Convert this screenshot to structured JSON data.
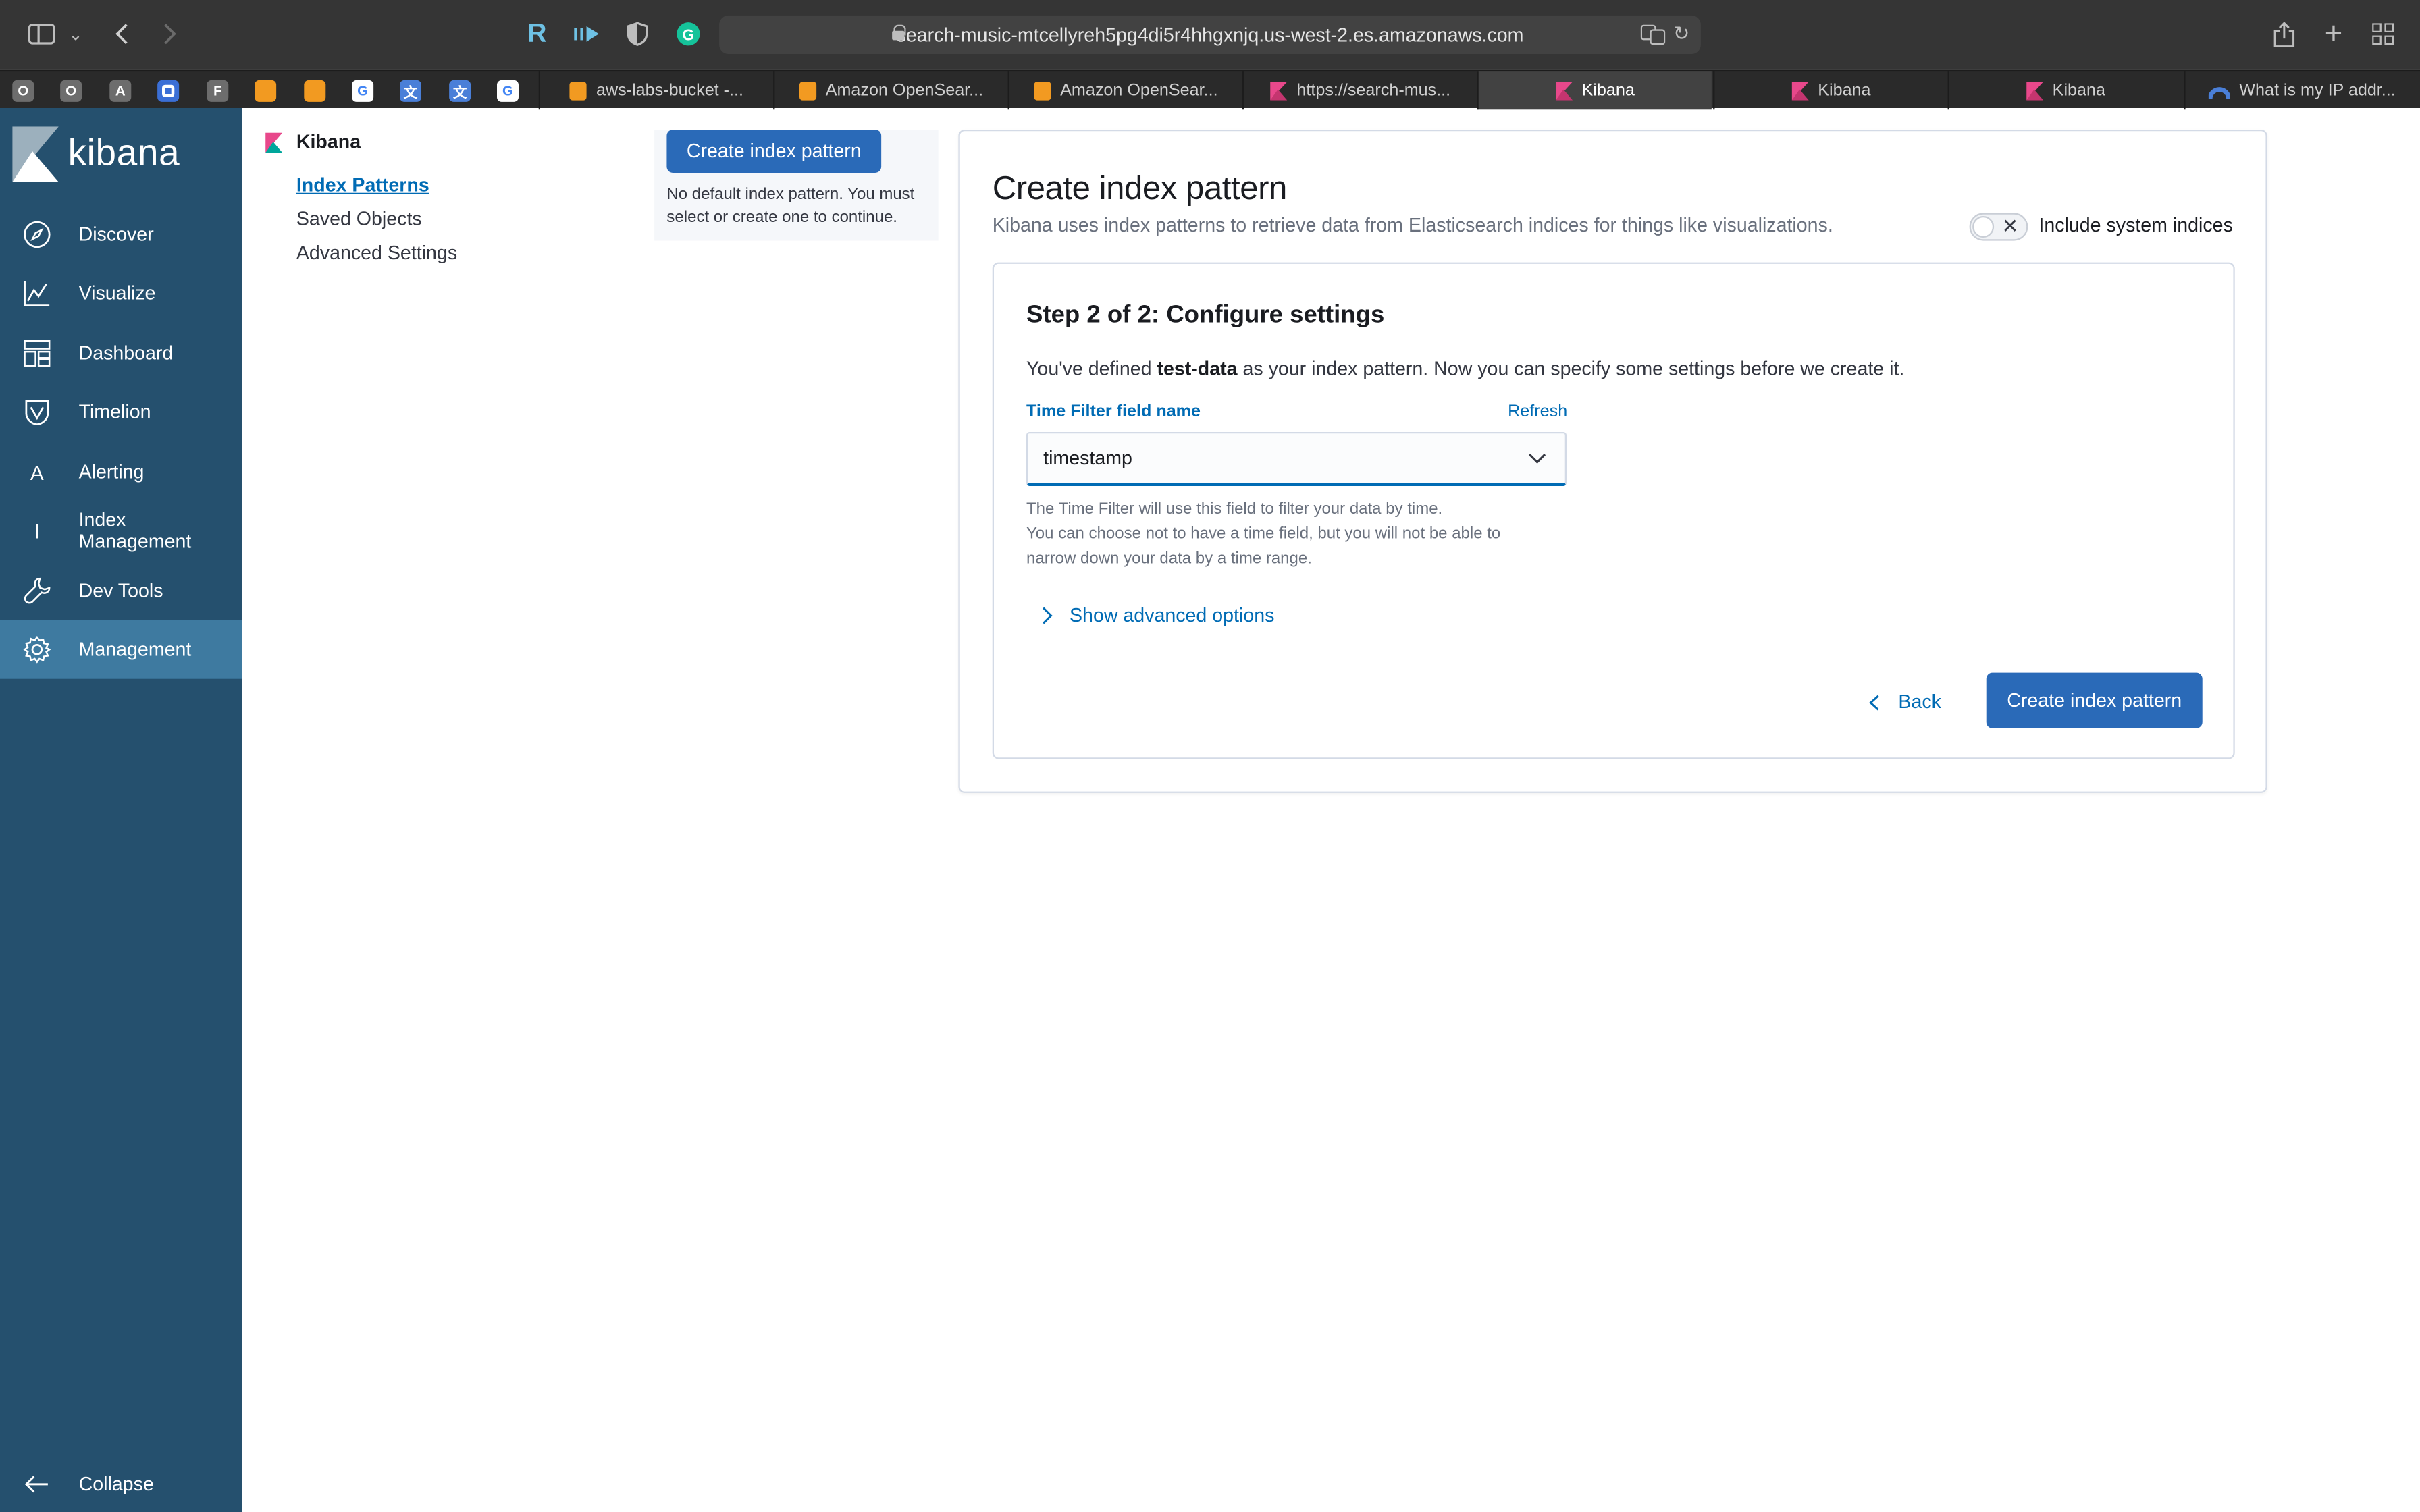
{
  "browser": {
    "url": "search-music-mtcellyreh5pg4di5r4hhgxnjq.us-west-2.es.amazonaws.com",
    "pinned_tabs": [
      "O",
      "O",
      "A",
      "",
      "F",
      "",
      "",
      "",
      "",
      "",
      ""
    ],
    "tabs": [
      {
        "title": "aws-labs-bucket -...",
        "favicon": "aws-icon",
        "active": false
      },
      {
        "title": "Amazon OpenSear...",
        "favicon": "aws-icon",
        "active": false
      },
      {
        "title": "Amazon OpenSear...",
        "favicon": "aws-icon",
        "active": false
      },
      {
        "title": "https://search-mus...",
        "favicon": "kibana-icon",
        "active": false
      },
      {
        "title": "Kibana",
        "favicon": "kibana-icon",
        "active": true
      },
      {
        "title": "Kibana",
        "favicon": "kibana-icon",
        "active": false
      },
      {
        "title": "Kibana",
        "favicon": "kibana-icon",
        "active": false
      },
      {
        "title": "What is my IP addr...",
        "favicon": "ip-icon",
        "active": false
      }
    ]
  },
  "sidebar": {
    "brand": "kibana",
    "items": [
      {
        "label": "Discover",
        "icon": "compass-icon"
      },
      {
        "label": "Visualize",
        "icon": "chart-icon"
      },
      {
        "label": "Dashboard",
        "icon": "dashboard-icon"
      },
      {
        "label": "Timelion",
        "icon": "timelion-icon"
      },
      {
        "label": "Alerting",
        "icon": "letter-a-icon",
        "glyph": "A"
      },
      {
        "label": "Index Management",
        "icon": "letter-i-icon",
        "glyph": "I"
      },
      {
        "label": "Dev Tools",
        "icon": "wrench-icon"
      },
      {
        "label": "Management",
        "icon": "gear-icon",
        "active": true
      }
    ],
    "collapse_label": "Collapse"
  },
  "subnav": {
    "title": "Kibana",
    "links": [
      "Index Patterns",
      "Saved Objects",
      "Advanced Settings"
    ],
    "selected": "Index Patterns"
  },
  "index_list": {
    "create_button": "Create index pattern",
    "hint": "No default index pattern. You must select or create one to continue."
  },
  "main": {
    "title": "Create index pattern",
    "description": "Kibana uses index patterns to retrieve data from Elasticsearch indices for things like visualizations.",
    "include_system_indices_label": "Include system indices",
    "include_system_indices": false,
    "step": {
      "title": "Step 2 of 2: Configure settings",
      "text_prefix": "You've defined ",
      "pattern_name": "test-data",
      "text_suffix": " as your index pattern. Now you can specify some settings before we create it.",
      "field_label": "Time Filter field name",
      "refresh_label": "Refresh",
      "time_field_value": "timestamp",
      "help_lines": [
        "The Time Filter will use this field to filter your data by time.",
        "You can choose not to have a time field, but you will not be able to",
        "narrow down your data by a time range."
      ],
      "advanced_label": "Show advanced options",
      "back_label": "Back",
      "create_label": "Create index pattern"
    }
  },
  "colors": {
    "nav_bg": "#25506e",
    "nav_active": "#3e7aa0",
    "primary": "#2a6ab8",
    "link": "#006bb4"
  }
}
